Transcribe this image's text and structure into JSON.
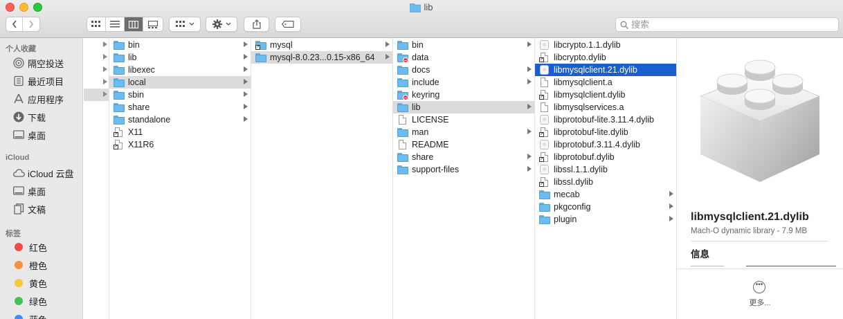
{
  "window": {
    "title": "lib"
  },
  "search": {
    "placeholder": "搜索"
  },
  "sidebar": {
    "sections": [
      {
        "label": "个人收藏"
      },
      {
        "label": "iCloud"
      },
      {
        "label": "标签"
      }
    ],
    "favorites": [
      {
        "label": "隔空投送",
        "icon": "airdrop-icon"
      },
      {
        "label": "最近项目",
        "icon": "recents-icon"
      },
      {
        "label": "应用程序",
        "icon": "applications-icon"
      },
      {
        "label": "下载",
        "icon": "downloads-icon"
      },
      {
        "label": "桌面",
        "icon": "desktop-icon"
      }
    ],
    "icloud": [
      {
        "label": "iCloud 云盘",
        "icon": "cloud-icon"
      },
      {
        "label": "桌面",
        "icon": "desktop-icon"
      },
      {
        "label": "文稿",
        "icon": "documents-icon"
      }
    ],
    "tags": [
      {
        "label": "红色",
        "color": "#f24a46"
      },
      {
        "label": "橙色",
        "color": "#f6913c"
      },
      {
        "label": "黄色",
        "color": "#f7c93a"
      },
      {
        "label": "绿色",
        "color": "#3fc456"
      },
      {
        "label": "蓝色",
        "color": "#3f8cf2"
      }
    ]
  },
  "columns": {
    "col1": [
      {
        "name": "bin",
        "type": "folder",
        "arrow": true
      },
      {
        "name": "lib",
        "type": "folder",
        "arrow": true
      },
      {
        "name": "libexec",
        "type": "folder",
        "arrow": true
      },
      {
        "name": "local",
        "type": "folder",
        "arrow": true,
        "selected": "gray"
      },
      {
        "name": "sbin",
        "type": "folder",
        "arrow": true
      },
      {
        "name": "share",
        "type": "folder",
        "arrow": true
      },
      {
        "name": "standalone",
        "type": "folder",
        "arrow": true
      },
      {
        "name": "X11",
        "type": "alias-doc"
      },
      {
        "name": "X11R6",
        "type": "alias-doc"
      }
    ],
    "col2": [
      {
        "name": "mysql",
        "type": "alias-folder",
        "arrow": true
      },
      {
        "name": "mysql-8.0.23...0.15-x86_64",
        "type": "folder",
        "arrow": true,
        "selected": "gray"
      }
    ],
    "col3": [
      {
        "name": "bin",
        "type": "folder",
        "arrow": true
      },
      {
        "name": "data",
        "type": "folder-locked"
      },
      {
        "name": "docs",
        "type": "folder",
        "arrow": true
      },
      {
        "name": "include",
        "type": "folder",
        "arrow": true
      },
      {
        "name": "keyring",
        "type": "folder-locked"
      },
      {
        "name": "lib",
        "type": "folder",
        "arrow": true,
        "selected": "gray"
      },
      {
        "name": "LICENSE",
        "type": "doc"
      },
      {
        "name": "man",
        "type": "folder",
        "arrow": true
      },
      {
        "name": "README",
        "type": "doc"
      },
      {
        "name": "share",
        "type": "folder",
        "arrow": true
      },
      {
        "name": "support-files",
        "type": "folder",
        "arrow": true
      }
    ],
    "col4": [
      {
        "name": "libcrypto.1.1.dylib",
        "type": "lib"
      },
      {
        "name": "libcrypto.dylib",
        "type": "alias-doc"
      },
      {
        "name": "libmysqlclient.21.dylib",
        "type": "lib",
        "selected": "blue"
      },
      {
        "name": "libmysqlclient.a",
        "type": "doc"
      },
      {
        "name": "libmysqlclient.dylib",
        "type": "alias-doc"
      },
      {
        "name": "libmysqlservices.a",
        "type": "doc"
      },
      {
        "name": "libprotobuf-lite.3.11.4.dylib",
        "type": "lib"
      },
      {
        "name": "libprotobuf-lite.dylib",
        "type": "alias-doc"
      },
      {
        "name": "libprotobuf.3.11.4.dylib",
        "type": "lib"
      },
      {
        "name": "libprotobuf.dylib",
        "type": "alias-doc"
      },
      {
        "name": "libssl.1.1.dylib",
        "type": "lib"
      },
      {
        "name": "libssl.dylib",
        "type": "alias-doc"
      },
      {
        "name": "mecab",
        "type": "folder",
        "arrow": true
      },
      {
        "name": "pkgconfig",
        "type": "folder",
        "arrow": true
      },
      {
        "name": "plugin",
        "type": "folder",
        "arrow": true
      }
    ]
  },
  "preview": {
    "name": "libmysqlclient.21.dylib",
    "kind": "Mach-O dynamic library - 7.9 MB",
    "info_label": "信息",
    "more_label": "更多..."
  }
}
